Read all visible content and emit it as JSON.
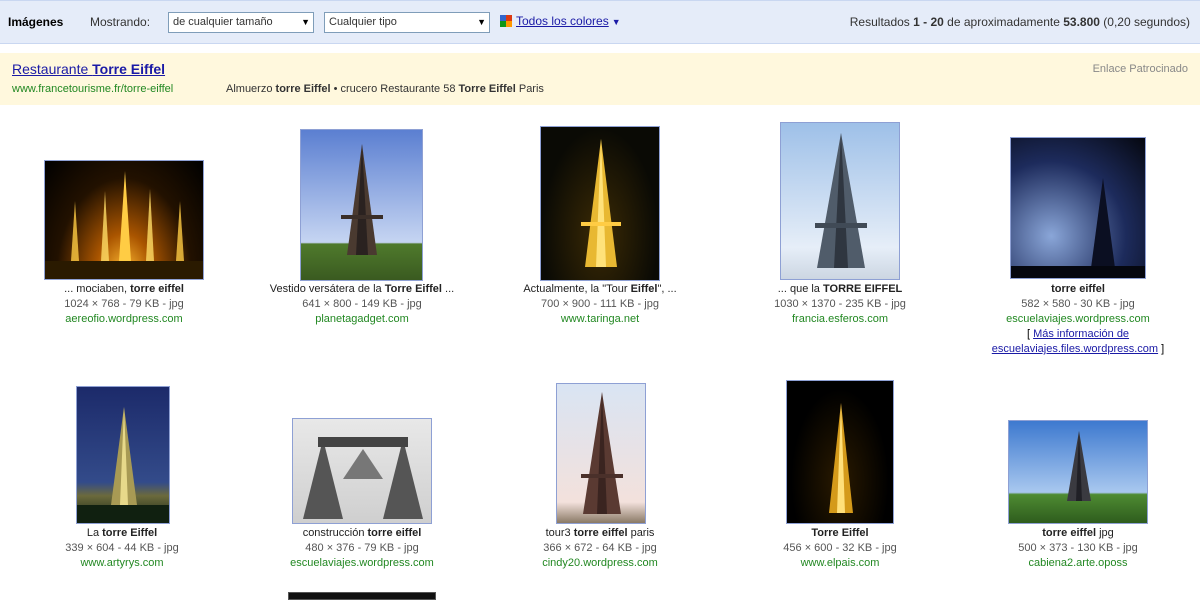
{
  "topbar": {
    "brand": "Imágenes",
    "showing_label": "Mostrando:",
    "size_select": "de cualquier tamaño",
    "type_select": "Cualquier tipo",
    "colors_link": "Todos los colores",
    "results_prefix": "Resultados ",
    "results_range": "1 - 20",
    "results_mid": " de aproximadamente ",
    "results_count": "53.800",
    "results_suffix": " (0,20 segundos)"
  },
  "ad": {
    "title_prefix": "Restaurante ",
    "title_bold": "Torre Eiffel",
    "url": "www.francetourisme.fr/torre-eiffel",
    "desc_prefix": "Almuerzo ",
    "desc_bold1": "torre Eiffel",
    "desc_mid": " • crucero Restaurante 58 ",
    "desc_bold2": "Torre Eiffel",
    "desc_suffix": " Paris",
    "label": "Enlace Patrocinado"
  },
  "results": [
    {
      "cap_pre": "... mociaben, ",
      "cap_bold": "torre eiffel",
      "cap_post": "",
      "meta": "1024 × 768 - 79 KB - jpg",
      "domain": "aereofio.wordpress.com"
    },
    {
      "cap_pre": "Vestido versátera de la ",
      "cap_bold": "Torre Eiffel",
      "cap_post": " ...",
      "meta": "641 × 800 - 149 KB - jpg",
      "domain": "planetagadget.com"
    },
    {
      "cap_pre": "Actualmente, la \"Tour ",
      "cap_bold": "Eiffel",
      "cap_post": "\", ...",
      "meta": "700 × 900 - 111 KB - jpg",
      "domain": "www.taringa.net"
    },
    {
      "cap_pre": "... que la ",
      "cap_bold": "TORRE EIFFEL",
      "cap_post": "",
      "meta": "1030 × 1370 - 235 KB - jpg",
      "domain": "francia.esferos.com"
    },
    {
      "cap_pre": "",
      "cap_bold": "torre eiffel",
      "cap_post": "",
      "meta": "582 × 580 - 30 KB - jpg",
      "domain": "escuelaviajes.wordpress.com",
      "extra_link": "Más información de escuelaviajes.files.wordpress.com"
    },
    {
      "cap_pre": "La ",
      "cap_bold": "torre Eiffel",
      "cap_post": "",
      "meta": "339 × 604 - 44 KB - jpg",
      "domain": "www.artyrys.com"
    },
    {
      "cap_pre": "construcción ",
      "cap_bold": "torre eiffel",
      "cap_post": "",
      "meta": "480 × 376 - 79 KB - jpg",
      "domain": "escuelaviajes.wordpress.com"
    },
    {
      "cap_pre": "tour3 ",
      "cap_bold": "torre eiffel",
      "cap_post": " paris",
      "meta": "366 × 672 - 64 KB - jpg",
      "domain": "cindy20.wordpress.com"
    },
    {
      "cap_pre": "",
      "cap_bold": "Torre Eiffel",
      "cap_post": "",
      "meta": "456 × 600 - 32 KB - jpg",
      "domain": "www.elpais.com"
    },
    {
      "cap_pre": "",
      "cap_bold": "torre eiffel",
      "cap_post": " jpg",
      "meta": "500 × 373 - 130 KB - jpg",
      "domain": "cabiena2.arte.oposs"
    }
  ],
  "colors": {
    "link": "#1a1aa6",
    "domain_green": "#228822",
    "topbar_bg": "#e5ecf9",
    "ad_bg": "#fff8dd"
  }
}
